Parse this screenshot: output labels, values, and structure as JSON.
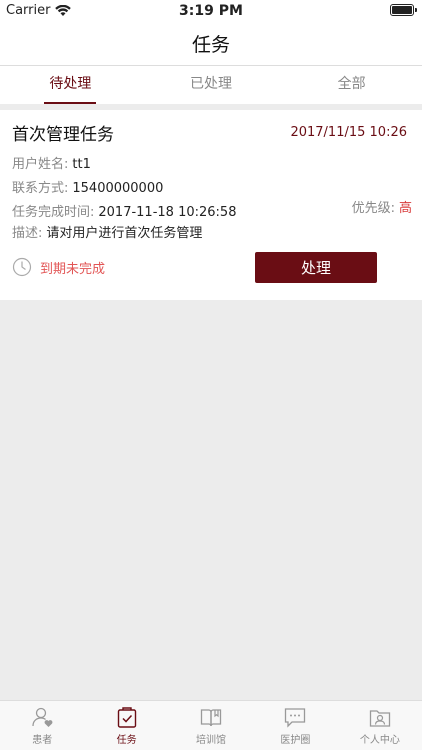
{
  "status": {
    "carrier": "Carrier",
    "time": "3:19 PM"
  },
  "nav": {
    "title": "任务"
  },
  "tabs": [
    {
      "label": "待处理",
      "active": true
    },
    {
      "label": "已处理",
      "active": false
    },
    {
      "label": "全部",
      "active": false
    }
  ],
  "task": {
    "title": "首次管理任务",
    "date": "2017/11/15 10:26",
    "user_label": "用户姓名:",
    "user_value": "tt1",
    "contact_label": "联系方式:",
    "contact_value": "15400000000",
    "deadline_label": "任务完成时间:",
    "deadline_value": "2017-11-18 10:26:58",
    "priority_label": "优先级:",
    "priority_value": "高",
    "desc_label": "描述:",
    "desc_value": "请对用户进行首次任务管理",
    "overdue_text": "到期未完成",
    "process_label": "处理"
  },
  "tabbar": [
    {
      "label": "患者",
      "icon": "patient-icon",
      "active": false
    },
    {
      "label": "任务",
      "icon": "task-icon",
      "active": true
    },
    {
      "label": "培训馆",
      "icon": "book-icon",
      "active": false
    },
    {
      "label": "医护圈",
      "icon": "chat-icon",
      "active": false
    },
    {
      "label": "个人中心",
      "icon": "profile-icon",
      "active": false
    }
  ],
  "colors": {
    "accent": "#6a0d14",
    "danger": "#e25555",
    "high": "#d83a3a"
  }
}
